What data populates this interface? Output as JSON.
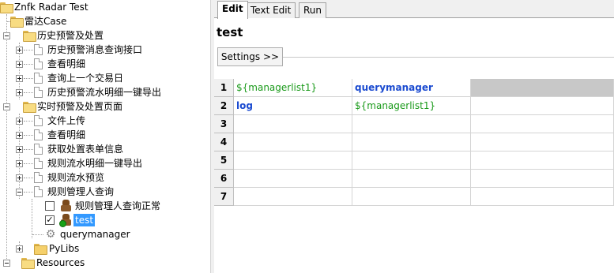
{
  "tree": {
    "root": "Znfk Radar Test",
    "suite": "雷达Case",
    "group1": {
      "label": "历史预警及处置",
      "items": [
        "历史预警消息查询接口",
        "查看明细",
        "查询上一个交易日",
        "历史预警流水明细一键导出"
      ]
    },
    "group2": {
      "label": "实时预警及处置页面",
      "items": [
        "文件上传",
        "查看明细",
        "获取处置表单信息",
        "规则流水明细一键导出",
        "规则流水预览",
        "规则管理人查询"
      ],
      "tests": [
        {
          "label": "规则管理人查询正常",
          "checked": "",
          "status_icon": "robot-icon"
        },
        {
          "label": "test",
          "checked": "✓",
          "status_icon": "robot-pass-icon"
        }
      ],
      "keyword": "querymanager"
    },
    "pylibs": "PyLibs",
    "resources": "Resources"
  },
  "tabs": [
    "Edit",
    "Text Edit",
    "Run"
  ],
  "active_tab": "Edit",
  "editor": {
    "title": "test",
    "settings_label": "Settings >>",
    "rows": [
      {
        "num": "1",
        "c1": "${managerlist1}",
        "c2": "querymanager"
      },
      {
        "num": "2",
        "c1": "log",
        "c2": "${managerlist1}"
      },
      {
        "num": "3",
        "c1": "",
        "c2": ""
      },
      {
        "num": "4",
        "c1": "",
        "c2": ""
      },
      {
        "num": "5",
        "c1": "",
        "c2": ""
      },
      {
        "num": "6",
        "c1": "",
        "c2": ""
      },
      {
        "num": "7",
        "c1": "",
        "c2": ""
      }
    ]
  },
  "colors": {
    "selection": "#3399ff",
    "variable": "#1a9a1a",
    "keyword": "#1a4ad0",
    "folder": "#f5d06b"
  }
}
